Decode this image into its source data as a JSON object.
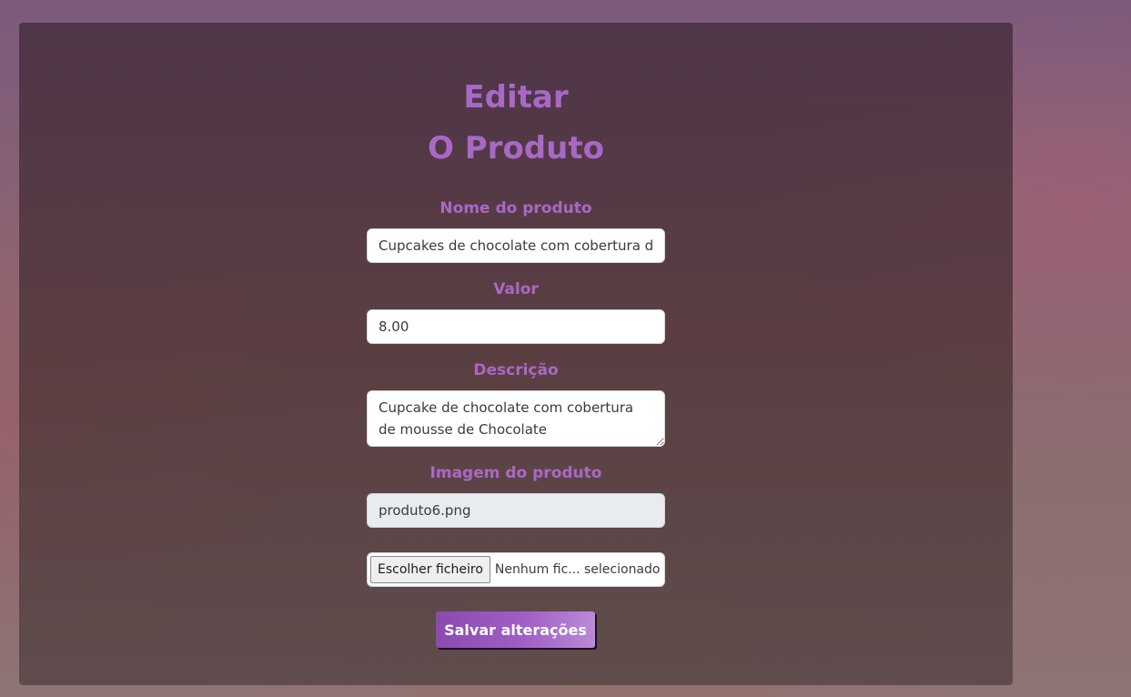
{
  "page": {
    "title_line1": "Editar",
    "title_line2": "O Produto"
  },
  "form": {
    "name_label": "Nome do produto",
    "name_value": "Cupcakes de chocolate com cobertura de mousse de Chocolate",
    "price_label": "Valor",
    "price_value": "8.00",
    "description_label": "Descrição",
    "description_value": "Cupcake de chocolate com cobertura de mousse de Chocolate",
    "image_label": "Imagem do produto",
    "image_value": "produto6.png",
    "file_button_label": "Escolher ficheiro",
    "file_status": "Nenhum fic... selecionado",
    "save_label": "Salvar alterações"
  },
  "colors": {
    "accent": "#a968c6",
    "button_start": "#8a4ab0",
    "button_end": "#b98ad6"
  }
}
